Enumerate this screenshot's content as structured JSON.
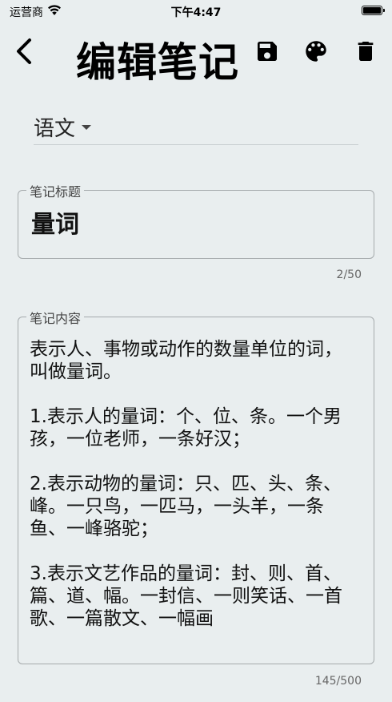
{
  "status_bar": {
    "carrier": "运营商",
    "time": "下午4:47"
  },
  "header": {
    "title": "编辑笔记",
    "back_icon": "chevron-left-icon",
    "actions": [
      "save-icon",
      "palette-icon",
      "delete-icon"
    ]
  },
  "subject": {
    "selected": "语文"
  },
  "title_field": {
    "label": "笔记标题",
    "value": "量词",
    "counter": "2/50"
  },
  "content_field": {
    "label": "笔记内容",
    "value": "表示人、事物或动作的数量单位的词，叫做量词。\n\n1.表示人的量词：个、位、条。一个男孩，一位老师，一条好汉；\n\n2.表示动物的量词：只、匹、头、条、峰。一只鸟，一匹马，一头羊，一条鱼、一峰骆驼；\n\n3.表示文艺作品的量词：封、则、首、篇、道、幅。一封信、一则笑话、一首歌、一篇散文、一幅画",
    "counter": "145/500"
  }
}
